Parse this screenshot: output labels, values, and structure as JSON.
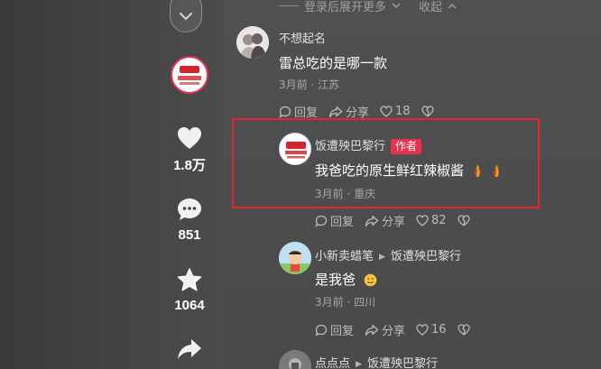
{
  "feed": {
    "likes": "1.8万",
    "comments": "851",
    "favorites": "1064"
  },
  "panel": {
    "expand_text": "登录后展开更多",
    "collapse_text": "收起"
  },
  "comments": [
    {
      "name": "不想起名",
      "text": "雷总吃的是哪一款",
      "meta": "3月前 · 江苏",
      "reply": "回复",
      "share": "分享",
      "likes": "18"
    },
    {
      "name": "饭遭殃巴黎行",
      "tag": "作者",
      "text": "我爸吃的原生鲜红辣椒酱",
      "meta": "3月前 · 重庆",
      "reply": "回复",
      "share": "分享",
      "likes": "82"
    },
    {
      "name": "小新卖蜡笔",
      "reply_to": "饭遭殃巴黎行",
      "text": "是我爸",
      "meta": "3月前 · 四川",
      "reply": "回复",
      "share": "分享",
      "likes": "16"
    },
    {
      "name": "点点点",
      "reply_to": "饭遭殃巴黎行"
    }
  ],
  "colors": {
    "author_tag": "#e8304f",
    "highlight_border": "#e8232e",
    "live_ring": "#e33458"
  }
}
